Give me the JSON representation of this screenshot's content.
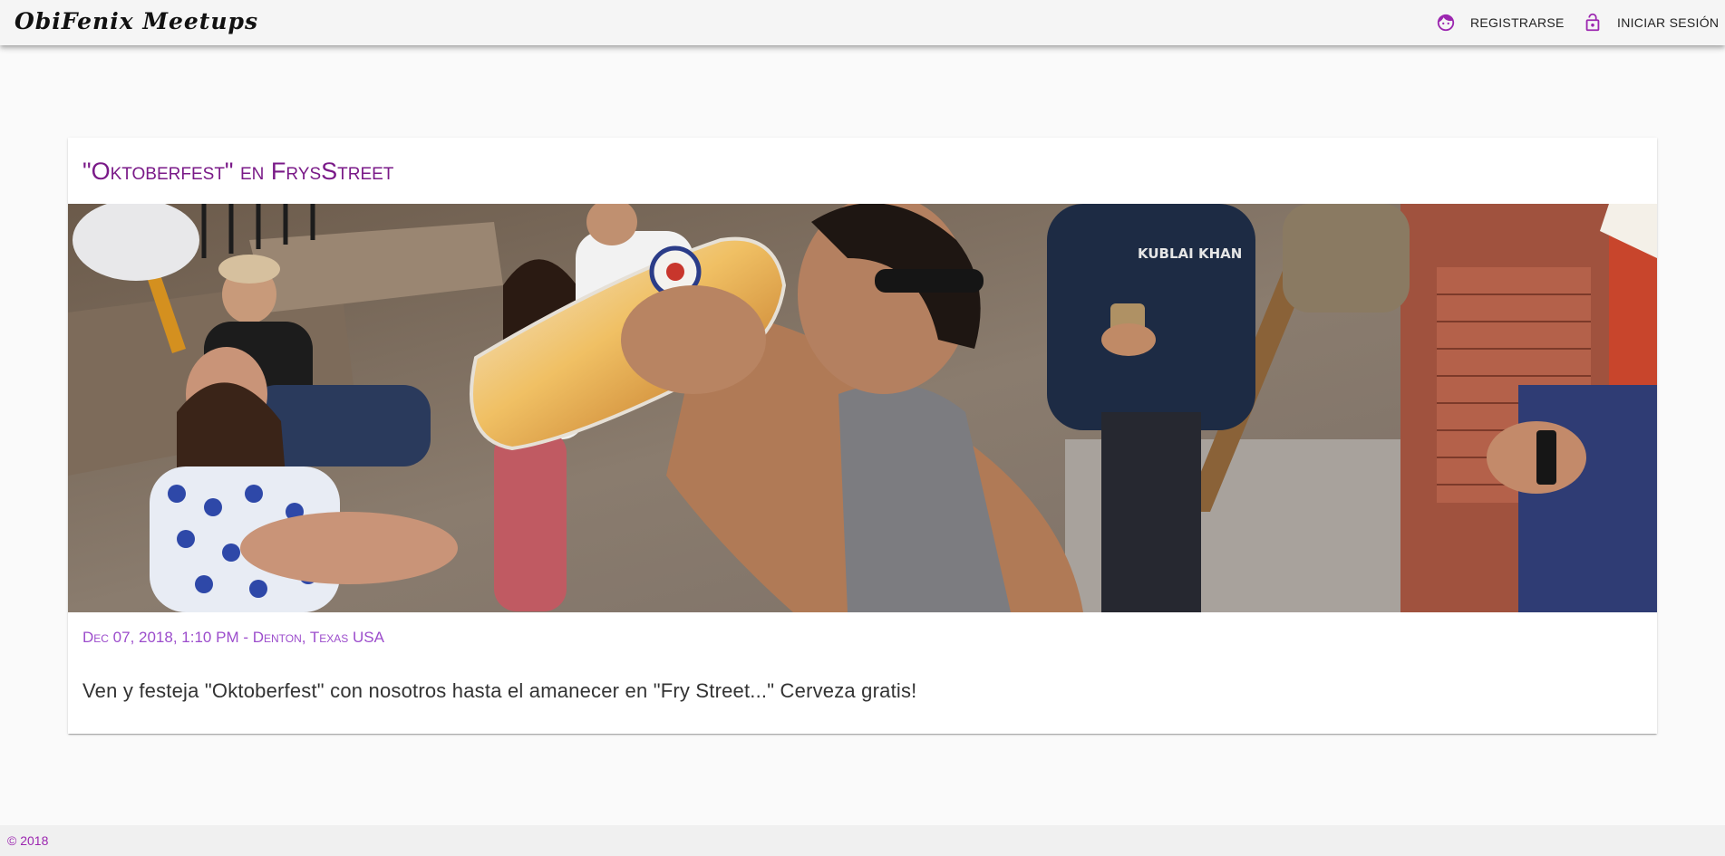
{
  "toolbar": {
    "brand": "ObiFenix Meetups",
    "register_label": "REGISTRARSE",
    "register_icon": "face-icon",
    "login_label": "INICIAR SESIÓN",
    "login_icon": "lock-open-icon"
  },
  "meetup": {
    "title": "\"Oktoberfest\" en FrysStreet",
    "meta": "Dec 07, 2018, 1:10 PM - Denton, Texas USA",
    "description": "Ven y festeja \"Oktoberfest\" con nosotros hasta el amanecer en \"Fry Street...\" Cerveza gratis!",
    "image_alt": "crowd-drinking-beer-photo"
  },
  "footer": {
    "copyright": "© 2018"
  },
  "colors": {
    "accent": "#9c27b0",
    "title": "#7a1a88",
    "meta": "#9c4dcc",
    "toolbar_bg": "#f5f5f5",
    "page_bg": "#fafafa"
  }
}
